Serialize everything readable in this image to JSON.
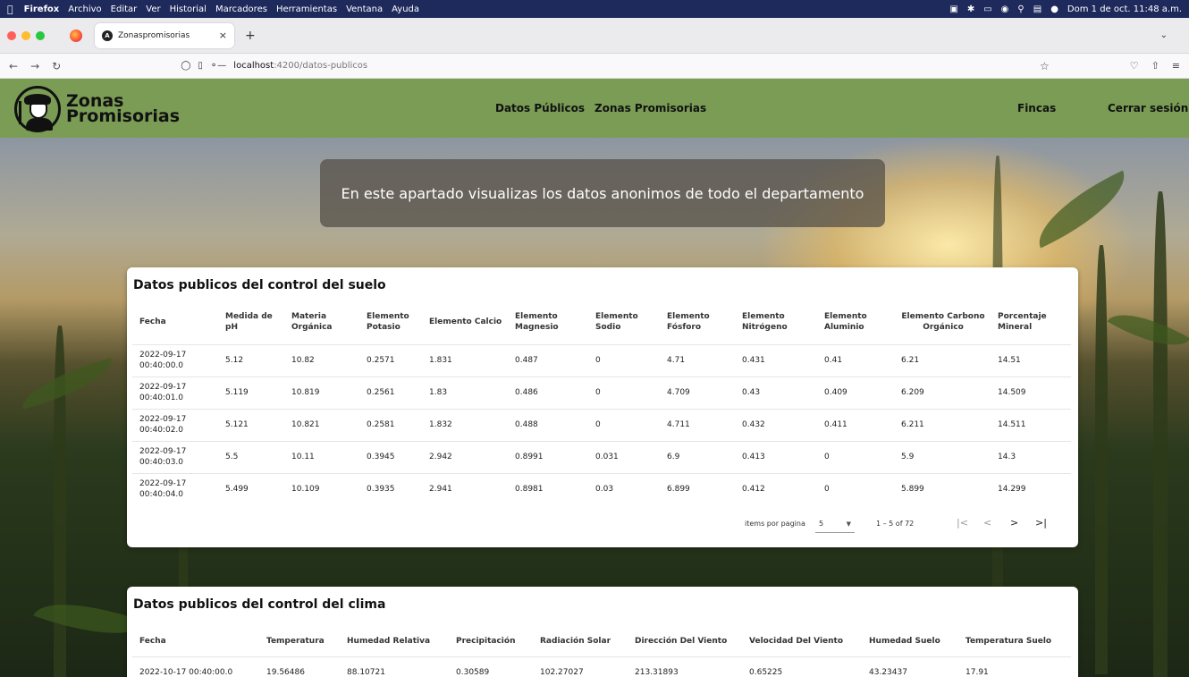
{
  "menubar": {
    "apple": "",
    "items": [
      "Firefox",
      "Archivo",
      "Editar",
      "Ver",
      "Historial",
      "Marcadores",
      "Herramientas",
      "Ventana",
      "Ayuda"
    ],
    "clock": "Dom 1 de oct. 11:48 a.m."
  },
  "browser": {
    "tab_title": "Zonaspromisorias",
    "favicon": "A",
    "url_host": "localhost",
    "url_path": ":4200/datos-publicos"
  },
  "header": {
    "logo_line1": "Zonas",
    "logo_line2": "Promisorias",
    "nav": [
      "Datos Públicos",
      "Zonas Promisorias"
    ],
    "fincas": "Fincas",
    "logout": "Cerrar sesión"
  },
  "banner": {
    "text": "En este apartado visualizas los datos anonimos de todo el departamento"
  },
  "soil": {
    "title": "Datos publicos del control del suelo",
    "headers": [
      "Fecha",
      "Medida de pH",
      "Materia Orgánica",
      "Elemento Potasio",
      "Elemento Calcio",
      "Elemento Magnesio",
      "Elemento Sodio",
      "Elemento Fósforo",
      "Elemento Nitrógeno",
      "Elemento Aluminio",
      "Elemento Carbono Orgánico",
      "Porcentaje Mineral"
    ],
    "rows": [
      [
        "2022-09-17 00:40:00.0",
        "5.12",
        "10.82",
        "0.2571",
        "1.831",
        "0.487",
        "0",
        "4.71",
        "0.431",
        "0.41",
        "6.21",
        "14.51"
      ],
      [
        "2022-09-17 00:40:01.0",
        "5.119",
        "10.819",
        "0.2561",
        "1.83",
        "0.486",
        "0",
        "4.709",
        "0.43",
        "0.409",
        "6.209",
        "14.509"
      ],
      [
        "2022-09-17 00:40:02.0",
        "5.121",
        "10.821",
        "0.2581",
        "1.832",
        "0.488",
        "0",
        "4.711",
        "0.432",
        "0.411",
        "6.211",
        "14.511"
      ],
      [
        "2022-09-17 00:40:03.0",
        "5.5",
        "10.11",
        "0.3945",
        "2.942",
        "0.8991",
        "0.031",
        "6.9",
        "0.413",
        "0",
        "5.9",
        "14.3"
      ],
      [
        "2022-09-17 00:40:04.0",
        "5.499",
        "10.109",
        "0.3935",
        "2.941",
        "0.8981",
        "0.03",
        "6.899",
        "0.412",
        "0",
        "5.899",
        "14.299"
      ]
    ],
    "pager_label": "items por pagina",
    "page_size": "5",
    "range": "1 – 5 of 72"
  },
  "climate": {
    "title": "Datos publicos del control del clima",
    "headers": [
      "Fecha",
      "Temperatura",
      "Humedad Relativa",
      "Precipitación",
      "Radiación Solar",
      "Dirección Del Viento",
      "Velocidad Del Viento",
      "Humedad Suelo",
      "Temperatura Suelo"
    ],
    "rows": [
      [
        "2022-10-17 00:40:00.0",
        "19.56486",
        "88.10721",
        "0.30589",
        "102.27027",
        "213.31893",
        "0.65225",
        "43.23437",
        "17.91"
      ]
    ]
  },
  "colors": {
    "header_green": "#7a9c55",
    "menubar": "#1e2a5c"
  }
}
